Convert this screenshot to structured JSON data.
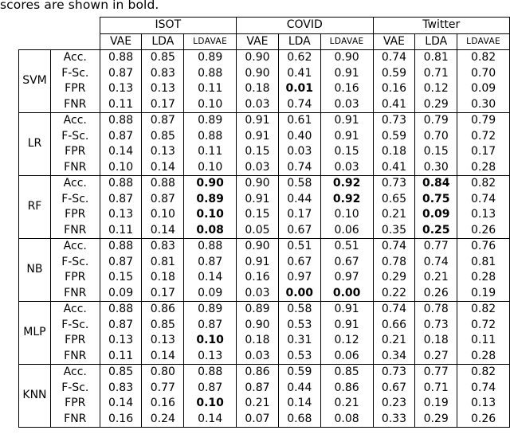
{
  "caption": "scores are shown in bold.",
  "table": {
    "corner_labels": [
      "",
      ""
    ],
    "dataset_groups": [
      "ISOT",
      "COVID",
      "Twitter"
    ],
    "method_columns": [
      "VAE",
      "LDA",
      "LDAVAE"
    ],
    "metrics": [
      "Acc.",
      "F-Sc.",
      "FPR",
      "FNR"
    ],
    "models": [
      "SVM",
      "LR",
      "RF",
      "NB",
      "MLP",
      "KNN"
    ],
    "rows": [
      {
        "model": "SVM",
        "metrics": [
          {
            "name": "Acc.",
            "values": [
              "0.88",
              "0.85",
              "0.89",
              "0.90",
              "0.62",
              "0.90",
              "0.74",
              "0.81",
              "0.82"
            ],
            "bold": [
              false,
              false,
              false,
              false,
              false,
              false,
              false,
              false,
              false
            ]
          },
          {
            "name": "F-Sc.",
            "values": [
              "0.87",
              "0.83",
              "0.88",
              "0.90",
              "0.41",
              "0.91",
              "0.59",
              "0.71",
              "0.70"
            ],
            "bold": [
              false,
              false,
              false,
              false,
              false,
              false,
              false,
              false,
              false
            ]
          },
          {
            "name": "FPR",
            "values": [
              "0.13",
              "0.13",
              "0.11",
              "0.18",
              "0.01",
              "0.16",
              "0.16",
              "0.12",
              "0.09"
            ],
            "bold": [
              false,
              false,
              false,
              false,
              true,
              false,
              false,
              false,
              false
            ]
          },
          {
            "name": "FNR",
            "values": [
              "0.11",
              "0.17",
              "0.10",
              "0.03",
              "0.74",
              "0.03",
              "0.41",
              "0.29",
              "0.30"
            ],
            "bold": [
              false,
              false,
              false,
              false,
              false,
              false,
              false,
              false,
              false
            ]
          }
        ]
      },
      {
        "model": "LR",
        "metrics": [
          {
            "name": "Acc.",
            "values": [
              "0.88",
              "0.87",
              "0.89",
              "0.91",
              "0.61",
              "0.91",
              "0.73",
              "0.79",
              "0.79"
            ],
            "bold": [
              false,
              false,
              false,
              false,
              false,
              false,
              false,
              false,
              false
            ]
          },
          {
            "name": "F-Sc.",
            "values": [
              "0.87",
              "0.85",
              "0.88",
              "0.91",
              "0.40",
              "0.91",
              "0.59",
              "0.70",
              "0.72"
            ],
            "bold": [
              false,
              false,
              false,
              false,
              false,
              false,
              false,
              false,
              false
            ]
          },
          {
            "name": "FPR",
            "values": [
              "0.14",
              "0.13",
              "0.11",
              "0.15",
              "0.03",
              "0.15",
              "0.18",
              "0.15",
              "0.17"
            ],
            "bold": [
              false,
              false,
              false,
              false,
              false,
              false,
              false,
              false,
              false
            ]
          },
          {
            "name": "FNR",
            "values": [
              "0.10",
              "0.14",
              "0.10",
              "0.03",
              "0.74",
              "0.03",
              "0.41",
              "0.30",
              "0.28"
            ],
            "bold": [
              false,
              false,
              false,
              false,
              false,
              false,
              false,
              false,
              false
            ]
          }
        ]
      },
      {
        "model": "RF",
        "metrics": [
          {
            "name": "Acc.",
            "values": [
              "0.88",
              "0.88",
              "0.90",
              "0.90",
              "0.58",
              "0.92",
              "0.73",
              "0.84",
              "0.82"
            ],
            "bold": [
              false,
              false,
              true,
              false,
              false,
              true,
              false,
              true,
              false
            ]
          },
          {
            "name": "F-Sc.",
            "values": [
              "0.87",
              "0.87",
              "0.89",
              "0.91",
              "0.44",
              "0.92",
              "0.65",
              "0.75",
              "0.74"
            ],
            "bold": [
              false,
              false,
              true,
              false,
              false,
              true,
              false,
              true,
              false
            ]
          },
          {
            "name": "FPR",
            "values": [
              "0.13",
              "0.10",
              "0.10",
              "0.15",
              "0.17",
              "0.10",
              "0.21",
              "0.09",
              "0.13"
            ],
            "bold": [
              false,
              false,
              true,
              false,
              false,
              false,
              false,
              true,
              false
            ]
          },
          {
            "name": "FNR",
            "values": [
              "0.11",
              "0.14",
              "0.08",
              "0.05",
              "0.67",
              "0.06",
              "0.35",
              "0.25",
              "0.26"
            ],
            "bold": [
              false,
              false,
              true,
              false,
              false,
              false,
              false,
              true,
              false
            ]
          }
        ]
      },
      {
        "model": "NB",
        "metrics": [
          {
            "name": "Acc.",
            "values": [
              "0.88",
              "0.83",
              "0.88",
              "0.90",
              "0.51",
              "0.51",
              "0.74",
              "0.77",
              "0.76"
            ],
            "bold": [
              false,
              false,
              false,
              false,
              false,
              false,
              false,
              false,
              false
            ]
          },
          {
            "name": "F-Sc.",
            "values": [
              "0.87",
              "0.81",
              "0.87",
              "0.91",
              "0.67",
              "0.67",
              "0.78",
              "0.74",
              "0.81"
            ],
            "bold": [
              false,
              false,
              false,
              false,
              false,
              false,
              false,
              false,
              false
            ]
          },
          {
            "name": "FPR",
            "values": [
              "0.15",
              "0.18",
              "0.14",
              "0.16",
              "0.97",
              "0.97",
              "0.29",
              "0.21",
              "0.28"
            ],
            "bold": [
              false,
              false,
              false,
              false,
              false,
              false,
              false,
              false,
              false
            ]
          },
          {
            "name": "FNR",
            "values": [
              "0.09",
              "0.17",
              "0.09",
              "0.03",
              "0.00",
              "0.00",
              "0.22",
              "0.26",
              "0.19"
            ],
            "bold": [
              false,
              false,
              false,
              false,
              true,
              true,
              false,
              false,
              false
            ]
          }
        ]
      },
      {
        "model": "MLP",
        "metrics": [
          {
            "name": "Acc.",
            "values": [
              "0.88",
              "0.86",
              "0.89",
              "0.89",
              "0.58",
              "0.91",
              "0.74",
              "0.78",
              "0.82"
            ],
            "bold": [
              false,
              false,
              false,
              false,
              false,
              false,
              false,
              false,
              false
            ]
          },
          {
            "name": "F-Sc.",
            "values": [
              "0.87",
              "0.85",
              "0.87",
              "0.90",
              "0.53",
              "0.91",
              "0.66",
              "0.73",
              "0.72"
            ],
            "bold": [
              false,
              false,
              false,
              false,
              false,
              false,
              false,
              false,
              false
            ]
          },
          {
            "name": "FPR",
            "values": [
              "0.13",
              "0.13",
              "0.10",
              "0.18",
              "0.31",
              "0.12",
              "0.21",
              "0.18",
              "0.11"
            ],
            "bold": [
              false,
              false,
              true,
              false,
              false,
              false,
              false,
              false,
              false
            ]
          },
          {
            "name": "FNR",
            "values": [
              "0.11",
              "0.14",
              "0.13",
              "0.03",
              "0.53",
              "0.06",
              "0.34",
              "0.27",
              "0.28"
            ],
            "bold": [
              false,
              false,
              false,
              false,
              false,
              false,
              false,
              false,
              false
            ]
          }
        ]
      },
      {
        "model": "KNN",
        "metrics": [
          {
            "name": "Acc.",
            "values": [
              "0.85",
              "0.80",
              "0.88",
              "0.86",
              "0.59",
              "0.85",
              "0.73",
              "0.77",
              "0.82"
            ],
            "bold": [
              false,
              false,
              false,
              false,
              false,
              false,
              false,
              false,
              false
            ]
          },
          {
            "name": "F-Sc.",
            "values": [
              "0.83",
              "0.77",
              "0.87",
              "0.87",
              "0.44",
              "0.86",
              "0.67",
              "0.71",
              "0.74"
            ],
            "bold": [
              false,
              false,
              false,
              false,
              false,
              false,
              false,
              false,
              false
            ]
          },
          {
            "name": "FPR",
            "values": [
              "0.14",
              "0.16",
              "0.10",
              "0.21",
              "0.14",
              "0.21",
              "0.23",
              "0.19",
              "0.13"
            ],
            "bold": [
              false,
              false,
              true,
              false,
              false,
              false,
              false,
              false,
              false
            ]
          },
          {
            "name": "FNR",
            "values": [
              "0.16",
              "0.24",
              "0.14",
              "0.07",
              "0.68",
              "0.08",
              "0.33",
              "0.29",
              "0.26"
            ],
            "bold": [
              false,
              false,
              false,
              false,
              false,
              false,
              false,
              false,
              false
            ]
          }
        ]
      }
    ]
  }
}
